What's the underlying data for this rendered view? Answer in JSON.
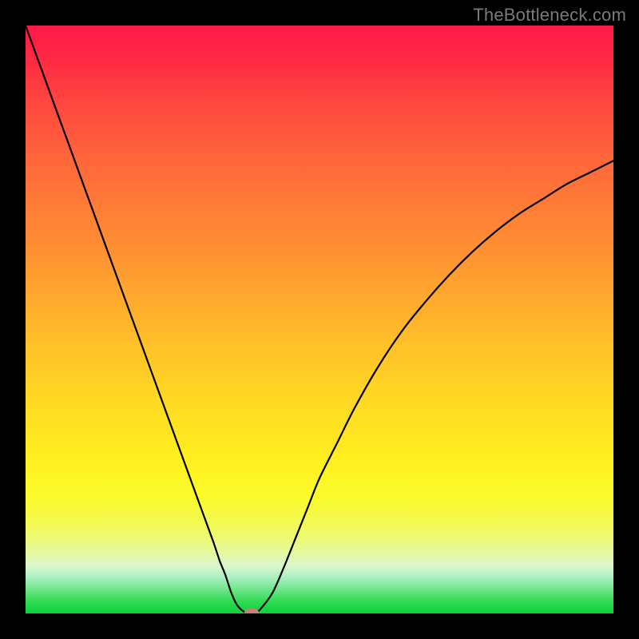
{
  "watermark": "TheBottleneck.com",
  "colors": {
    "frame": "#000000",
    "curve": "#000000",
    "marker": "#c97f78"
  },
  "chart_data": {
    "type": "line",
    "title": "",
    "xlabel": "",
    "ylabel": "",
    "xlim": [
      0,
      100
    ],
    "ylim": [
      0,
      100
    ],
    "grid": false,
    "legend": false,
    "series": [
      {
        "name": "bottleneck-curve",
        "x": [
          0,
          2,
          4,
          6,
          8,
          10,
          12,
          14,
          16,
          18,
          20,
          22,
          24,
          26,
          28,
          30,
          32,
          33,
          34,
          35,
          36,
          37,
          38,
          39,
          40,
          42,
          44,
          46,
          48,
          50,
          53,
          56,
          60,
          64,
          68,
          72,
          76,
          80,
          84,
          88,
          92,
          96,
          100
        ],
        "y": [
          100,
          94.5,
          89,
          83.5,
          78,
          72.5,
          67,
          61.5,
          56,
          50.5,
          45,
          39.5,
          34,
          28.5,
          23,
          17.5,
          12,
          9,
          6.5,
          3.5,
          1.4,
          0.4,
          0.0,
          0.0,
          0.8,
          3.5,
          8,
          13,
          18,
          23,
          29,
          35,
          42,
          48,
          53,
          57.5,
          61.5,
          65,
          68,
          70.5,
          73,
          75,
          77
        ]
      }
    ],
    "marker": {
      "x": 38.5,
      "y": 0
    },
    "gradient_stops": [
      {
        "pos": 0.0,
        "color": "#ff1847"
      },
      {
        "pos": 0.06,
        "color": "#ff2b43"
      },
      {
        "pos": 0.14,
        "color": "#ff4a3f"
      },
      {
        "pos": 0.24,
        "color": "#ff6a3a"
      },
      {
        "pos": 0.36,
        "color": "#ff8a34"
      },
      {
        "pos": 0.46,
        "color": "#ffa82e"
      },
      {
        "pos": 0.56,
        "color": "#ffc527"
      },
      {
        "pos": 0.66,
        "color": "#ffde22"
      },
      {
        "pos": 0.74,
        "color": "#fff01f"
      },
      {
        "pos": 0.8,
        "color": "#fbfb2a"
      },
      {
        "pos": 0.85,
        "color": "#f2fa56"
      },
      {
        "pos": 0.89,
        "color": "#e8f992"
      },
      {
        "pos": 0.92,
        "color": "#d9f7cc"
      },
      {
        "pos": 0.94,
        "color": "#a7efc0"
      },
      {
        "pos": 0.96,
        "color": "#6be586"
      },
      {
        "pos": 0.98,
        "color": "#2edb52"
      },
      {
        "pos": 1.0,
        "color": "#0ad23a"
      }
    ]
  }
}
